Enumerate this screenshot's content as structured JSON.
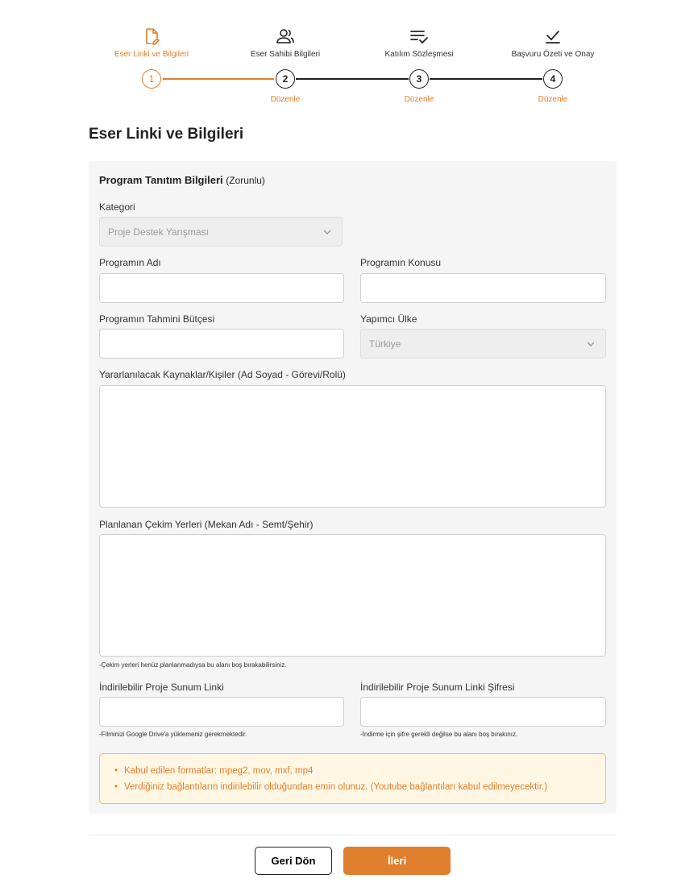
{
  "stepper": {
    "steps": [
      {
        "number": "1",
        "label": "Eser Linki ve Bilgileri",
        "icon": "edit-document-icon",
        "edit": ""
      },
      {
        "number": "2",
        "label": "Eser Sahibi Bilgileri",
        "icon": "users-icon",
        "edit": "Düzenle"
      },
      {
        "number": "3",
        "label": "Katılım Sözleşmesi",
        "icon": "list-check-icon",
        "edit": "Düzenle"
      },
      {
        "number": "4",
        "label": "Başvuru Özeti ve Onay",
        "icon": "check-icon",
        "edit": "Düzenle"
      }
    ]
  },
  "page_title": "Eser Linki ve Bilgileri",
  "section": {
    "title": "Program Tanıtım Bilgileri",
    "note": "(Zorunlu)"
  },
  "form": {
    "kategori_label": "Kategori",
    "kategori_value": "Proje Destek Yarışması",
    "program_adi_label": "Programın Adı",
    "program_adi_value": "",
    "program_konusu_label": "Programın Konusu",
    "program_konusu_value": "",
    "butce_label": "Programın Tahmini Bütçesi",
    "butce_value": "",
    "ulke_label": "Yapımcı Ülke",
    "ulke_value": "Türkiye",
    "kaynaklar_label": "Yararlanılacak Kaynaklar/Kişiler (Ad Soyad - Görevi/Rolü)",
    "kaynaklar_value": "",
    "cekim_label": "Planlanan Çekim Yerleri (Mekan Adı - Semt/Şehir)",
    "cekim_value": "",
    "cekim_hint": "-Çekim yerleri henüz planlanmadıysa bu alanı boş bırakabilirsiniz.",
    "link_label": "İndirilebilir Proje Sunum Linki",
    "link_value": "",
    "link_hint": "-Filminizi Google Drive'a yüklemeniz gerekmektedir.",
    "sifre_label": "İndirilebilir Proje Sunum Linki Şifresi",
    "sifre_value": "",
    "sifre_hint": "-İndirme için şifre gerekli değilse bu alanı boş bırakınız."
  },
  "notice": [
    "Kabul edilen formatlar: mpeg2, mov, mxf, mp4",
    "Verdiğiniz bağlantıların indirilebilir olduğundan emin olunuz. (Youtube bağlantıları kabul edilmeyecektir.)"
  ],
  "buttons": {
    "back": "Geri Dön",
    "next": "İleri"
  },
  "colors": {
    "accent": "#e07f2d",
    "notice_bg": "#fff7e3",
    "notice_border": "#f0c040"
  }
}
